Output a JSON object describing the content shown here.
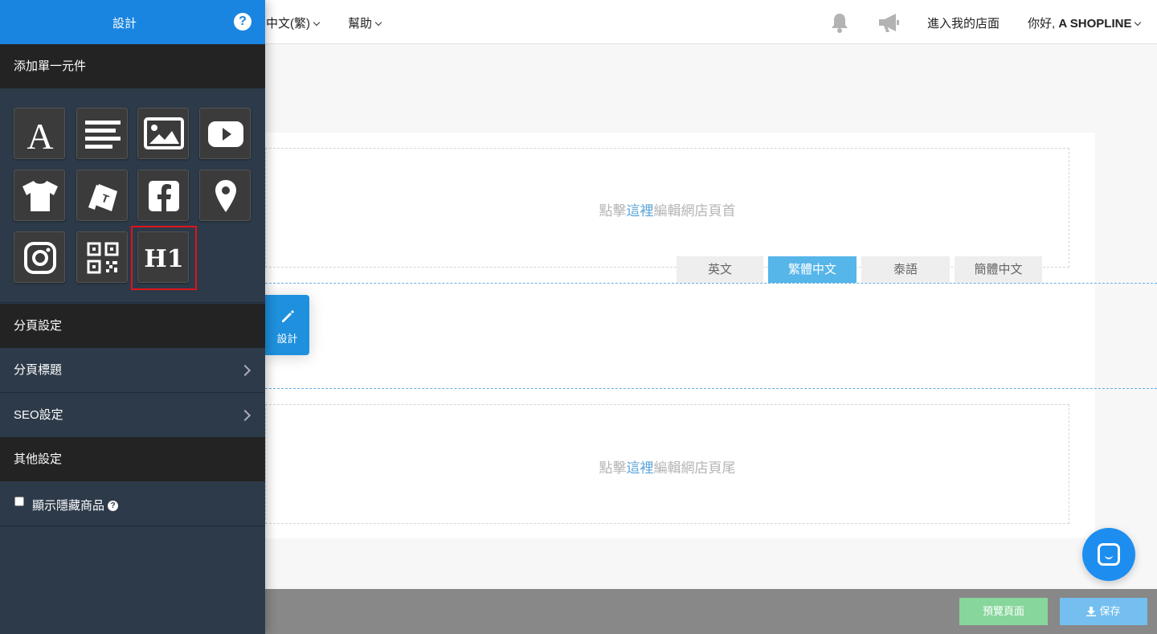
{
  "topbar": {
    "language": "中文(繁)",
    "help": "幫助",
    "enter_store": "進入我的店面",
    "greeting_prefix": "你好, ",
    "greeting_name": "A SHOPLINE"
  },
  "sidebar": {
    "title": "設計",
    "add_widget_section": "添加單一元件",
    "widgets": [
      {
        "name": "text-widget",
        "icon": "letter-a-icon"
      },
      {
        "name": "paragraph-widget",
        "icon": "align-left-icon"
      },
      {
        "name": "image-widget",
        "icon": "image-icon"
      },
      {
        "name": "youtube-widget",
        "icon": "youtube-icon"
      },
      {
        "name": "product-widget",
        "icon": "tshirt-icon"
      },
      {
        "name": "category-widget",
        "icon": "tags-icon"
      },
      {
        "name": "facebook-widget",
        "icon": "facebook-icon"
      },
      {
        "name": "map-widget",
        "icon": "map-pin-icon"
      },
      {
        "name": "instagram-widget",
        "icon": "instagram-icon"
      },
      {
        "name": "qrcode-widget",
        "icon": "qrcode-icon"
      },
      {
        "name": "h1-widget",
        "icon": "h1-icon",
        "label": "H1"
      }
    ],
    "page_settings_section": "分頁設定",
    "page_title_item": "分頁標題",
    "seo_item": "SEO設定",
    "other_settings_section": "其他設定",
    "show_hidden_products": "顯示隱藏商品"
  },
  "canvas": {
    "header_text_before": "點擊",
    "header_text_link": "這裡",
    "header_text_after": "編輯網店頁首",
    "footer_text_before": "點擊",
    "footer_text_link": "這裡",
    "footer_text_after": "編輯網店頁尾",
    "language_tabs": [
      "英文",
      "繁體中文",
      "泰語",
      "簡體中文"
    ],
    "active_language": "繁體中文",
    "design_button": "設計"
  },
  "bottombar": {
    "preview": "預覽頁面",
    "save": "保存"
  },
  "colors": {
    "primary": "#1985e0",
    "sidebar_bg": "#2d3a49",
    "section_bg": "#232323",
    "highlight": "#e0141b",
    "preview_green": "#87d69b",
    "save_blue": "#74bff0"
  }
}
